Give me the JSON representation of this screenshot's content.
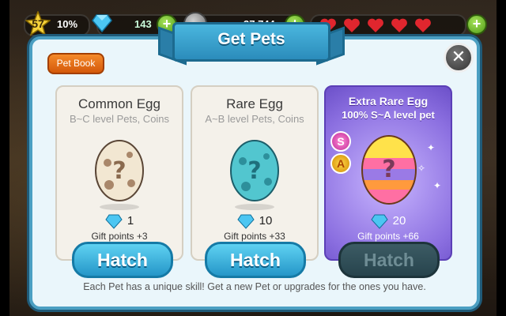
{
  "hud": {
    "level": "57",
    "level_progress": "10%",
    "gems": "143",
    "coins": "37,744",
    "hearts_count": 5
  },
  "dialog": {
    "title": "Get Pets",
    "pet_book_label": "Pet Book",
    "footer_text": "Each Pet has a unique skill! Get a new Pet or upgrades for the ones you have."
  },
  "cards": [
    {
      "title": "Common Egg",
      "subtitle": "B~C level Pets, Coins",
      "cost": "1",
      "gift_points": "Gift points +3",
      "button_label": "Hatch",
      "button_enabled": true
    },
    {
      "title": "Rare Egg",
      "subtitle": "A~B level Pets, Coins",
      "cost": "10",
      "gift_points": "Gift points +33",
      "button_label": "Hatch",
      "button_enabled": true
    },
    {
      "title": "Extra Rare Egg",
      "subtitle": "100% S~A level pet",
      "cost": "20",
      "gift_points": "Gift points +66",
      "button_label": "Hatch",
      "button_enabled": false,
      "grade_badges": [
        "S",
        "A"
      ]
    }
  ],
  "colors": {
    "accent_blue": "#2b8cbb",
    "extra_purple": "#8b6fe0",
    "hatch_disabled": "#27444d"
  }
}
